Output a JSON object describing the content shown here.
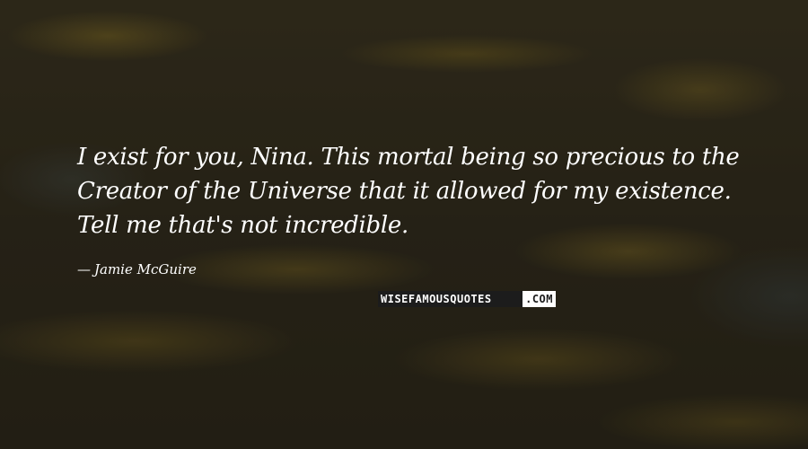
{
  "quote": {
    "text": "I exist for you, Nina. This mortal being so precious to the Creator of the Universe that it allowed for my existence. Tell me that's not incredible.",
    "author_dash": "—",
    "author": "Jamie McGuire"
  },
  "watermark": {
    "text_main": "WISEFAMOUSQUOTES",
    "text_suffix": ".COM"
  }
}
